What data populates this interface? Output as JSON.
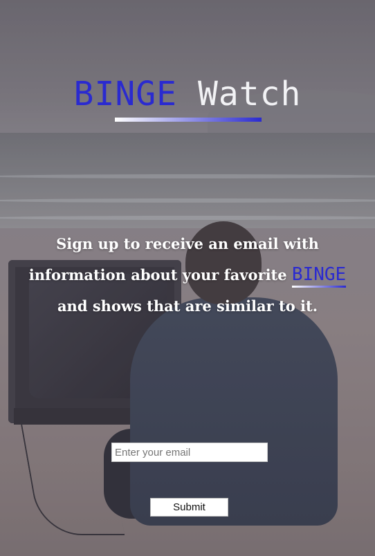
{
  "brand": {
    "name_part_1": "BINGE",
    "name_part_2": "Watch",
    "accent_color": "#2a2ad0",
    "text_color": "#f2f2f5"
  },
  "tagline": {
    "line_1": "Sign up to receive an email with",
    "line_2": "information about your favorite",
    "highlight_word": "BINGE",
    "line_3": "and shows that are similar to it."
  },
  "form": {
    "email_placeholder": "Enter your email",
    "email_value": "",
    "submit_label": "Submit"
  }
}
